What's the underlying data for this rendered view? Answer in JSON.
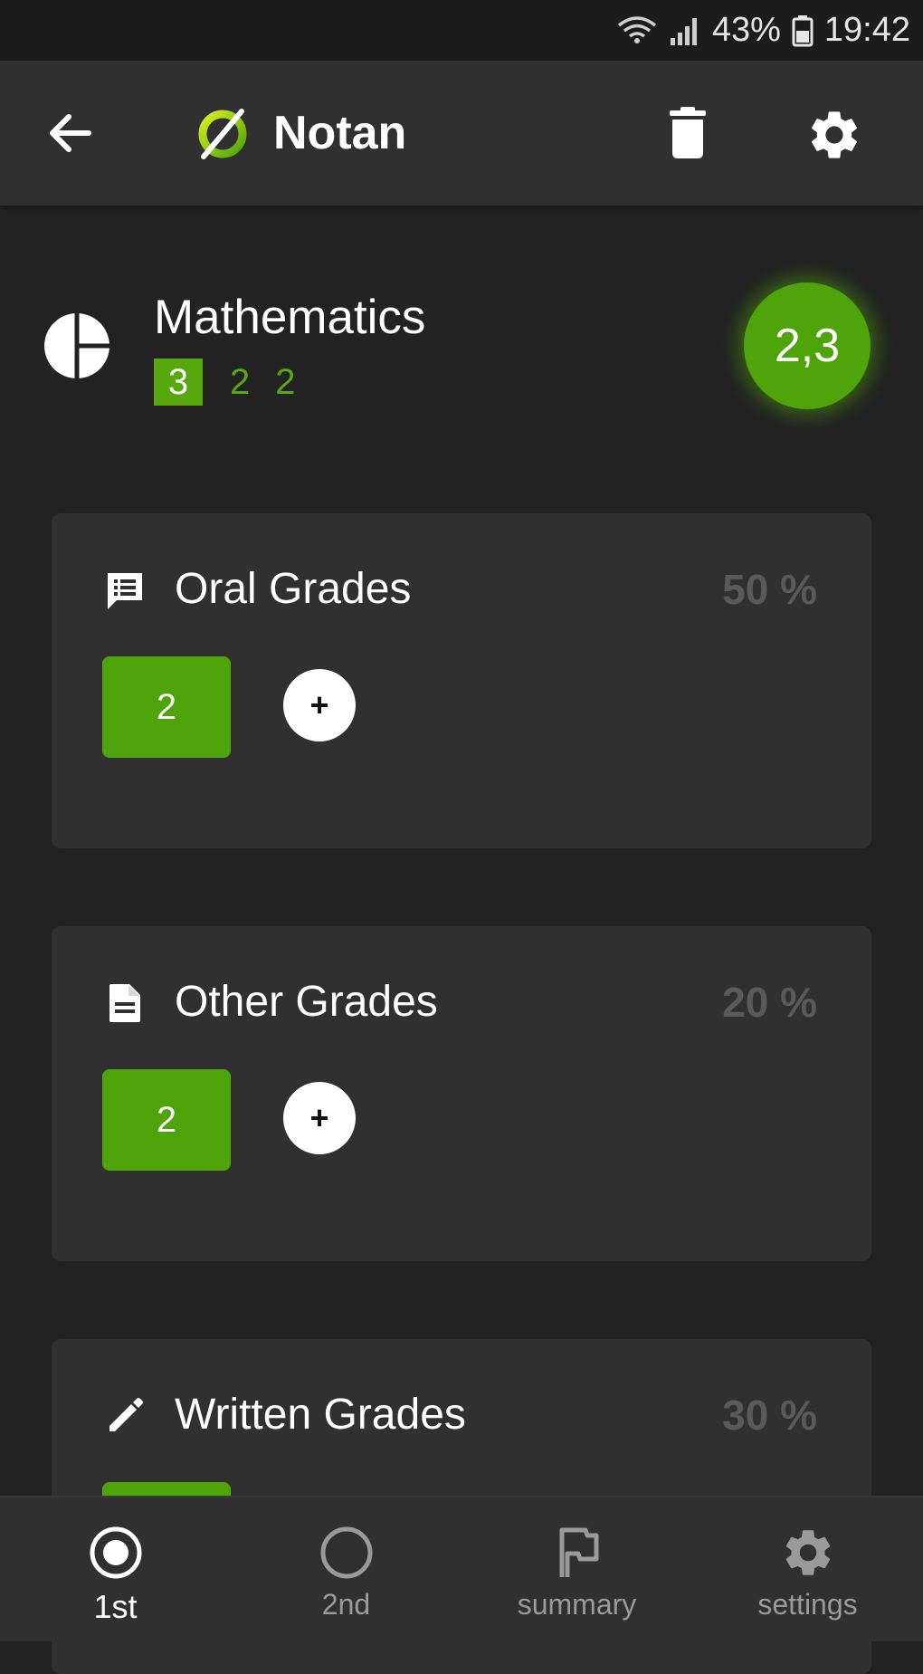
{
  "status_bar": {
    "battery": "43%",
    "time": "19:42"
  },
  "toolbar": {
    "title": "Notan",
    "icons": {
      "back": "arrow-left-icon",
      "logo": "notan-logo-icon",
      "delete": "trash-icon",
      "settings": "gear-icon"
    }
  },
  "subject": {
    "name": "Mathematics",
    "grades": [
      "3",
      "2",
      "2"
    ],
    "selected_grade_index": 0,
    "average": "2,3",
    "icon": "pie-chart-icon"
  },
  "cards": [
    {
      "title": "Oral Grades",
      "weight": "50 %",
      "icon": "message-icon",
      "grades": [
        "2"
      ],
      "add_label": "+"
    },
    {
      "title": "Other Grades",
      "weight": "20 %",
      "icon": "document-icon",
      "grades": [
        "2"
      ],
      "add_label": "+"
    },
    {
      "title": "Written Grades",
      "weight": "30 %",
      "icon": "pencil-icon",
      "grades": [],
      "add_label": "+"
    }
  ],
  "bottom_nav": {
    "items": [
      {
        "label": "1st",
        "icon": "radio-checked-icon",
        "active": true
      },
      {
        "label": "2nd",
        "icon": "radio-unchecked-icon",
        "active": false
      },
      {
        "label": "summary",
        "icon": "flag-icon",
        "active": false
      },
      {
        "label": "settings",
        "icon": "gear-icon",
        "active": false
      }
    ]
  },
  "colors": {
    "accent": "#4ea40a",
    "background": "#222222",
    "surface": "#303030",
    "muted_text": "#5a5a5a"
  }
}
